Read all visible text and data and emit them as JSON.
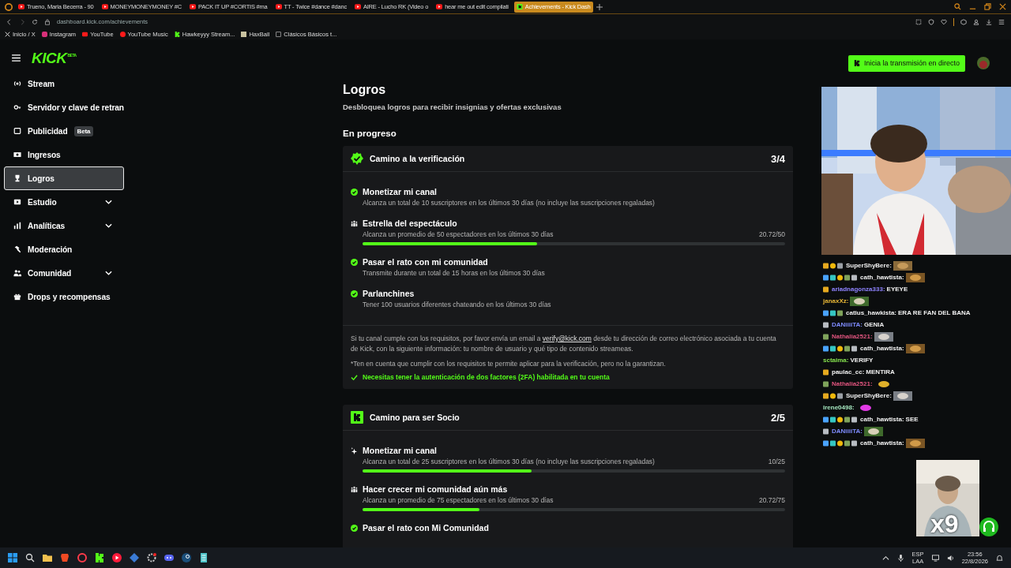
{
  "browser": {
    "tabs": [
      {
        "title": "Trueno, Maria Becerra - 90",
        "kind": "video",
        "selected": false
      },
      {
        "title": "MONEYMONEYMONEY #C",
        "kind": "video",
        "selected": false
      },
      {
        "title": "PACK IT UP #CORTIS #ma",
        "kind": "video",
        "selected": false
      },
      {
        "title": "TT - Twice #dance #danc",
        "kind": "video",
        "selected": false
      },
      {
        "title": "AIRE - Lucho RK (Video o",
        "kind": "video",
        "selected": false
      },
      {
        "title": "hear me out edit compilati",
        "kind": "video",
        "selected": false
      },
      {
        "title": "Achievements - Kick Dash",
        "kind": "dashboard",
        "selected": true
      }
    ],
    "address": "dashboard.kick.com/achievements",
    "bookmarks": [
      "Inicio / X",
      "Instagram",
      "YouTube",
      "YouTube Music",
      "Hawkeyyy Stream...",
      "HaxBall",
      "Clásicos Básicos t..."
    ]
  },
  "header": {
    "logo": "KICK",
    "logo_badge": "BETA",
    "go_live": "Inicia la transmisión en directo"
  },
  "sidebar": {
    "items": [
      {
        "label": "Stream",
        "expandable": false,
        "selected": false
      },
      {
        "label": "Servidor y clave de retran",
        "expandable": false,
        "selected": false
      },
      {
        "label": "Publicidad",
        "badge": "Beta",
        "expandable": false,
        "selected": false
      },
      {
        "label": "Ingresos",
        "expandable": false,
        "selected": false
      },
      {
        "label": "Logros",
        "expandable": false,
        "selected": true
      },
      {
        "label": "Estudio",
        "expandable": true,
        "selected": false
      },
      {
        "label": "Analíticas",
        "expandable": true,
        "selected": false
      },
      {
        "label": "Moderación",
        "expandable": false,
        "selected": false
      },
      {
        "label": "Comunidad",
        "expandable": true,
        "selected": false
      },
      {
        "label": "Drops y recompensas",
        "expandable": false,
        "selected": false
      }
    ]
  },
  "main": {
    "title": "Logros",
    "subtitle": "Desbloquea logros para recibir insignias y ofertas exclusivas",
    "section": "En progreso",
    "cards": [
      {
        "title": "Camino a la verificación",
        "count": "3/4",
        "items": [
          {
            "kind": "done",
            "title": "Monetizar mi canal",
            "desc": "Alcanza un total de 10 suscriptores en los últimos 30 días (no incluye las suscripciones regaladas)"
          },
          {
            "kind": "viewers",
            "title": "Estrella del espectáculo",
            "desc": "Alcanza un promedio de 50 espectadores en los últimos 30 días",
            "reading": "20.72/50",
            "level": 0.414
          },
          {
            "kind": "done",
            "title": "Pasar el rato con mi comunidad",
            "desc": "Transmite durante un total de 15 horas en los últimos 30 días"
          },
          {
            "kind": "done",
            "title": "Parlanchines",
            "desc": "Tener 100 usuarios diferentes chateando en los últimos 30 días"
          }
        ],
        "note": {
          "before": "Si tu canal cumple con los requisitos, por favor envía un email a",
          "email": "verify@kick.com",
          "after": "desde tu dirección de correo electrónico asociada a tu cuenta de Kick, con la siguiente información: tu nombre de usuario y qué tipo de contenido streameas.",
          "disclaimer": "*Ten en cuenta que cumplir con los requisitos te permite aplicar para la verificación, pero no la garantizan.",
          "requirement": "Necesitas tener la autenticación de dos factores (2FA) habilitada en tu cuenta",
          "requirement_met": true
        }
      },
      {
        "title": "Camino para ser Socio",
        "count": "2/5",
        "items": [
          {
            "kind": "subscribers",
            "title": "Monetizar mi canal",
            "desc": "Alcanza un total de 25 suscriptores en los últimos 30 días (no incluye las suscripciones regaladas)",
            "reading": "10/25",
            "level": 0.4
          },
          {
            "kind": "viewers",
            "title": "Hacer crecer mi comunidad aún más",
            "desc": "Alcanza un promedio de 75 espectadores en los últimos 30 días",
            "reading": "20.72/75",
            "level": 0.276
          },
          {
            "kind": "done",
            "title": "Pasar el rato con Mi Comunidad"
          }
        ]
      }
    ]
  },
  "stream": {
    "chat": [
      {
        "user": "SuperShyBere:",
        "color": "#f2f2f2",
        "kind": "emote"
      },
      {
        "user": "cath_hawtista:",
        "color": "#f2f2f2",
        "kind": "emote"
      },
      {
        "user": "ariadnagonza333:",
        "color": "#8f83ff",
        "kind": "text",
        "text": "EYEYE"
      },
      {
        "user": "janaxXz:",
        "color": "#e6b536",
        "kind": "emote"
      },
      {
        "user": "catius_hawkista:",
        "color": "#f2f2f2",
        "kind": "text",
        "text": "ERA RE FAN DEL BANA"
      },
      {
        "user": "DANiiiiTA:",
        "color": "#7f8cff",
        "kind": "text",
        "text": "GENIA"
      },
      {
        "user": "Nathalia2521:",
        "color": "#e2557f",
        "kind": "emote"
      },
      {
        "user": "cath_hawtista:",
        "color": "#f2f2f2",
        "kind": "emote"
      },
      {
        "user": "sctaima:",
        "color": "#86e34e",
        "kind": "text",
        "text": "VERIFY"
      },
      {
        "user": "paulac_cc:",
        "color": "#f2f2f2",
        "kind": "text",
        "text": "MENTIRA"
      },
      {
        "user": "Nathalia2521:",
        "color": "#e2557f",
        "kind": "emote"
      },
      {
        "user": "SuperShyBere:",
        "color": "#f2f2f2",
        "kind": "emote"
      },
      {
        "user": "irene0498:",
        "color": "#a6e8c0",
        "kind": "emote"
      },
      {
        "user": "cath_hawtista:",
        "color": "#f2f2f2",
        "kind": "text",
        "text": "SEE"
      },
      {
        "user": "DANiiiiTA:",
        "color": "#7f8cff",
        "kind": "emote"
      },
      {
        "user": "cath_hawtista:",
        "color": "#f2f2f2",
        "kind": "emote"
      }
    ],
    "multiplier": "x9"
  },
  "taskbar": {
    "language": "ESP",
    "layout": "LAA",
    "time": "23:56",
    "date": "22/8/2026"
  }
}
